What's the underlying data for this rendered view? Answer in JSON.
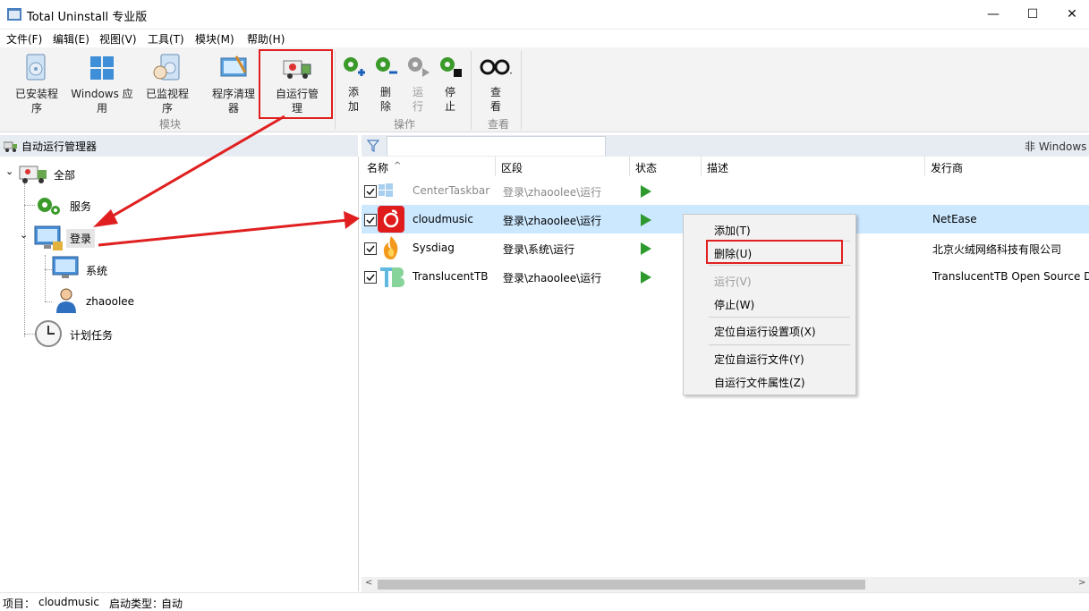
{
  "window": {
    "title": "Total Uninstall 专业版",
    "minimize": "—",
    "maximize": "☐",
    "close": "✕"
  },
  "menu": [
    "文件(F)",
    "编辑(E)",
    "视图(V)",
    "工具(T)",
    "模块(M)",
    "帮助(H)"
  ],
  "ribbon": {
    "modules": [
      {
        "label1": "已安装程",
        "label2": "序",
        "icon": "installed-programs-icon"
      },
      {
        "label1": "Windows 应",
        "label2": "用",
        "icon": "windows-apps-icon"
      },
      {
        "label1": "已监视程",
        "label2": "序",
        "icon": "monitored-programs-icon"
      },
      {
        "label1": "程序清理",
        "label2": "器",
        "icon": "program-cleaner-icon"
      },
      {
        "label1": "自运行管",
        "label2": "理",
        "icon": "autorun-manager-icon"
      }
    ],
    "modules_group": "模块",
    "actions": [
      {
        "label1": "添",
        "label2": "加",
        "icon": "add-gear-icon"
      },
      {
        "label1": "删",
        "label2": "除",
        "icon": "delete-gear-icon"
      },
      {
        "label1": "运",
        "label2": "行",
        "icon": "run-gear-icon"
      },
      {
        "label1": "停",
        "label2": "止",
        "icon": "stop-gear-icon"
      }
    ],
    "actions_group": "操作",
    "view": {
      "label1": "查",
      "label2": "看",
      "group": "查看"
    }
  },
  "left_pane": {
    "header": "自动运行管理器",
    "tree": {
      "all": "全部",
      "services": "服务",
      "login": "登录",
      "system": "系统",
      "user": "zhaoolee",
      "tasks": "计划任务"
    }
  },
  "right_pane": {
    "filter_placeholder": "",
    "right_label": "非 Windows",
    "columns": [
      "名称",
      "区段",
      "状态",
      "描述",
      "发行商"
    ],
    "sort_indicator": "^",
    "rows": [
      {
        "name": "CenterTaskbar",
        "section": "登录\\zhaoolee\\运行",
        "desc": "",
        "publisher": "",
        "dim": true
      },
      {
        "name": "cloudmusic",
        "section": "登录\\zhaoolee\\运行",
        "desc": "",
        "publisher": "NetEase",
        "selected": true
      },
      {
        "name": "Sysdiag",
        "section": "登录\\系统\\运行",
        "desc": "",
        "publisher": "北京火绒网络科技有限公司"
      },
      {
        "name": "TranslucentTB",
        "section": "登录\\zhaoolee\\运行",
        "desc": "",
        "publisher": "TranslucentTB Open Source D"
      }
    ]
  },
  "context_menu": {
    "add": "添加(T)",
    "delete": "删除(U)",
    "run": "运行(V)",
    "stop": "停止(W)",
    "locate_item": "定位自运行设置项(X)",
    "locate_file": "定位自运行文件(Y)",
    "file_props": "自运行文件属性(Z)"
  },
  "status_bar": {
    "item_label": "项目：",
    "item_value": "cloudmusic",
    "start_label": "启动类型：",
    "start_value": "自动"
  },
  "colors": {
    "accent_red": "#e02020",
    "selection": "#cce8ff",
    "play_green": "#2e9a2e"
  }
}
